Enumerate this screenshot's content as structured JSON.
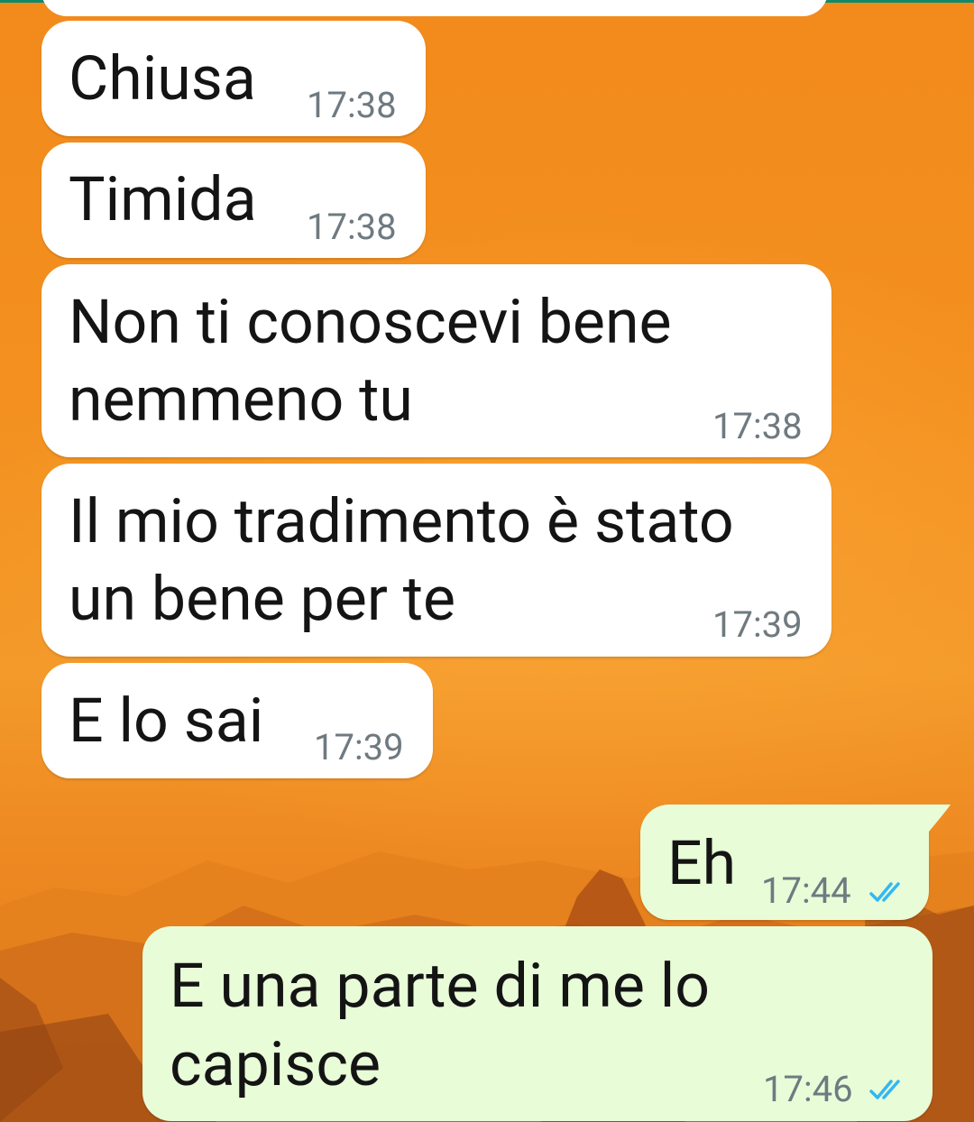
{
  "chat": {
    "messages": [
      {
        "text": "Chiusa",
        "time": "17:38",
        "direction": "incoming"
      },
      {
        "text": "Timida",
        "time": "17:38",
        "direction": "incoming"
      },
      {
        "line1": "Non ti conoscevi bene",
        "line2": "nemmeno tu",
        "time": "17:38",
        "direction": "incoming"
      },
      {
        "line1": "Il mio tradimento è stato",
        "line2": "un bene per te",
        "time": "17:39",
        "direction": "incoming"
      },
      {
        "text": "E lo sai",
        "time": "17:39",
        "direction": "incoming"
      },
      {
        "text": "Eh",
        "time": "17:44",
        "direction": "outgoing",
        "status_icon": "double-check-read-icon"
      },
      {
        "line1": "E una parte di me lo",
        "line2": "capisce",
        "time": "17:46",
        "direction": "outgoing",
        "status_icon": "double-check-read-icon"
      }
    ]
  },
  "colors": {
    "incoming_bubble": "#ffffff",
    "outgoing_bubble": "#e8fcd8",
    "read_tick": "#34b7f1",
    "accent_line": "#0f8a6a"
  },
  "wallpaper": "orange-sunset-mountains"
}
